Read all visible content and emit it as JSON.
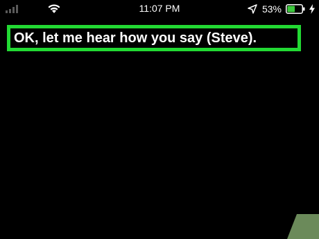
{
  "status_bar": {
    "time": "11:07 PM",
    "battery_percent": "53%",
    "battery_level": 0.53,
    "icons": {
      "signal": "cellular-signal-icon",
      "wifi": "wifi-icon",
      "location": "location-arrow-icon",
      "battery": "battery-icon",
      "charging": "charging-bolt-icon"
    }
  },
  "siri": {
    "message": "OK, let me hear how you say (Steve)."
  },
  "colors": {
    "highlight_border": "#22d933",
    "battery_fill": "#3cc83c",
    "background": "#000000",
    "corner_accent": "#6b8a5a"
  }
}
